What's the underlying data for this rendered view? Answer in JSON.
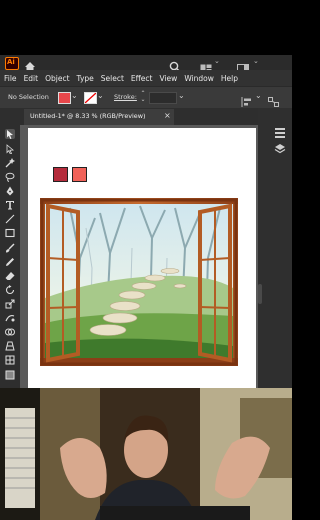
{
  "app": {
    "name": "Ai",
    "brand_color": "#ff7c00"
  },
  "menu": [
    "File",
    "Edit",
    "Object",
    "Type",
    "Select",
    "Effect",
    "View",
    "Window",
    "Help"
  ],
  "control_bar": {
    "selection_label": "No Selection",
    "stroke_label": "Stroke:",
    "fill_color": "#e8474b",
    "stroke_color": "#ffffff"
  },
  "document_tab": {
    "title": "Untitled-1* @ 8.33 % (RGB/Preview)",
    "close": "×"
  },
  "artboard": {
    "swatches": [
      "#b52c3c",
      "#f06259"
    ]
  },
  "icons": [
    "home-icon",
    "search-icon",
    "arrange-documents-icon",
    "workspace-icon",
    "selection-tool-icon",
    "direct-selection-tool-icon",
    "magic-wand-icon",
    "lasso-icon",
    "pen-tool-icon",
    "type-tool-icon",
    "line-tool-icon",
    "rectangle-tool-icon",
    "paintbrush-icon",
    "pencil-icon",
    "eraser-icon",
    "rotate-icon",
    "scale-icon",
    "warp-icon",
    "shape-builder-icon",
    "properties-icon",
    "layers-icon"
  ]
}
